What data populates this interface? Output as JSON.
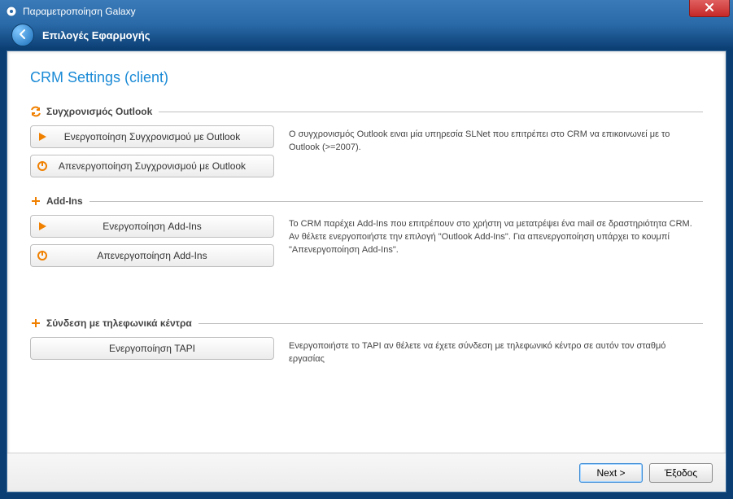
{
  "window": {
    "title": "Παραμετροποίηση Galaxy",
    "subtitle": "Επιλογές Εφαρμογής"
  },
  "page": {
    "title": "CRM Settings (client)"
  },
  "groups": {
    "outlook": {
      "title": "Συγχρονισμός Outlook",
      "enable_label": "Ενεργοποίηση Συγχρονισμού με Outlook",
      "disable_label": "Απενεργοποίηση Συγχρονισμού με Outlook",
      "desc": "Ο συγχρονισμός Outlook ειναι μία υπηρεσία SLNet που επιτρέπει στο CRM να επικοινωνεί με το Outlook (>=2007)."
    },
    "addins": {
      "title": "Add-Ins",
      "enable_label": "Ενεργοποίηση Add-Ins",
      "disable_label": "Απενεργοποίηση Add-Ins",
      "desc": "Το CRM παρέχει Add-Ins που επιτρέπουν στο χρήστη να μετατρέψει ένα mail σε δραστηριότητα CRM. Αν θέλετε ενεργοποιήστε την επιλογή \"Outlook Add-Ins\". Για απενεργοποίηση υπάρχει το κουμπί \"Απενεργοποίηση Add-Ins\"."
    },
    "tapi": {
      "title": "Σύνδεση με τηλεφωνικά κέντρα",
      "enable_label": "Ενεργοποίηση TAPI",
      "desc": "Ενεργοποιήστε το TAPI αν θέλετε να έχετε σύνδεση με τηλεφωνικό κέντρο σε αυτόν τον σταθμό εργασίας"
    }
  },
  "footer": {
    "next": "Next >",
    "exit": "Έξοδος"
  }
}
